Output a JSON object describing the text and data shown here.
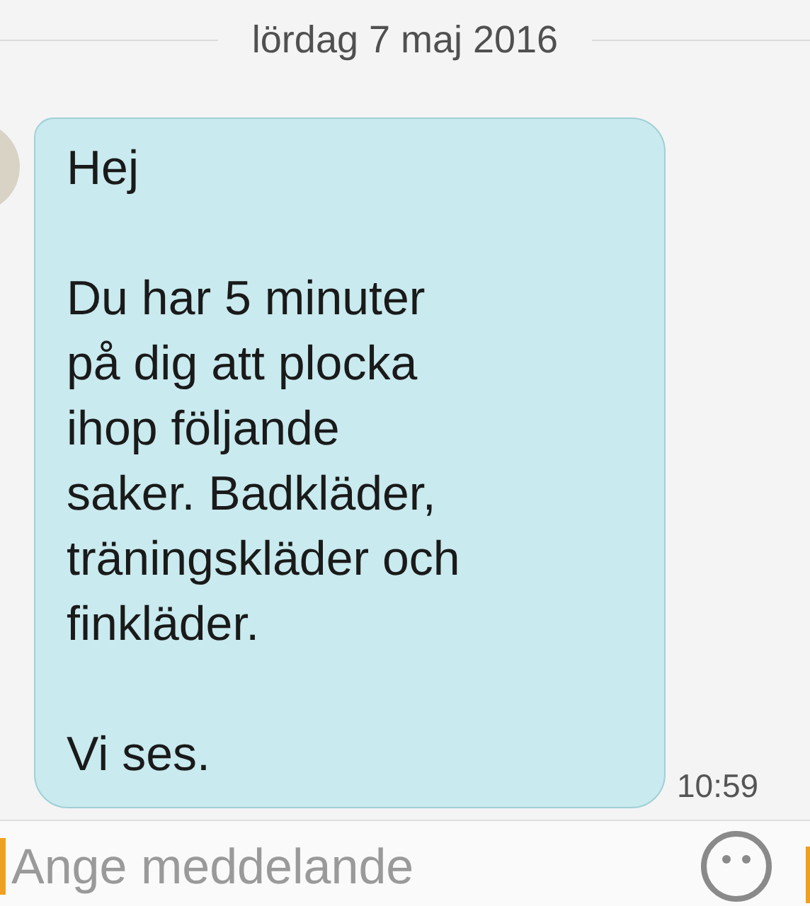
{
  "date_separator": "lördag 7 maj 2016",
  "message": {
    "text": "Hej\n\nDu har 5 minuter\npå dig att plocka\nihop följande\nsaker. Badkläder,\nträningskläder och\nfinkläder.\n\nVi ses.",
    "time": "10:59"
  },
  "composer": {
    "placeholder": "Ange meddelande"
  }
}
